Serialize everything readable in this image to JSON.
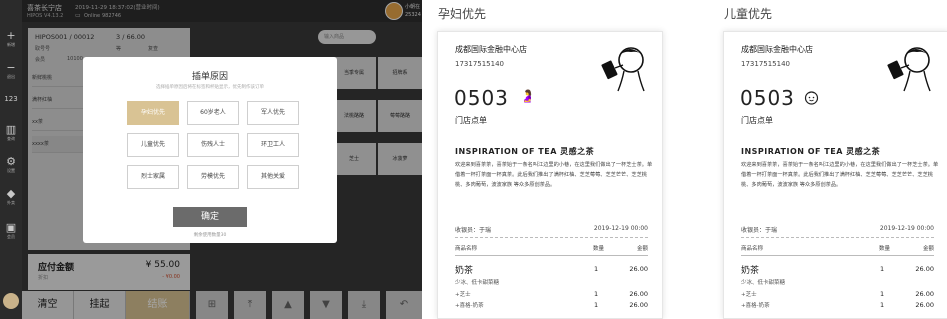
{
  "pos": {
    "header": {
      "store_name": "喜茶长宁店",
      "version": "HIPOS V4.13.2",
      "datetime": "2019-11-29 18:37:02(营业时间)",
      "online_status": "Online",
      "terminal_id": "982746",
      "user_name": "小朝在",
      "user_id": "25324"
    },
    "rail": [
      "新增",
      "退出",
      "123",
      "查询",
      "设置",
      "外卖",
      "会员"
    ],
    "order": {
      "order_no": "HIPOS001 / 00012",
      "progress": "3 / 66.00",
      "row2_a": "取号号",
      "row2_b": "等",
      "row2_c": "复查",
      "row3_a": "会员",
      "row3_b": "10100",
      "items": [
        "新鲜桃桃",
        "满杯红柚",
        "xx茶",
        "xxxx茶"
      ]
    },
    "amount": {
      "label": "应付金额",
      "sub": "折扣",
      "value": "¥ 55.00",
      "discount": "- ¥0.00"
    },
    "buttons": {
      "clear": "清空",
      "hold": "挂起",
      "checkout": "结账"
    },
    "search_placeholder": "输入商品",
    "categories": [
      "当季专属",
      "招牌系",
      "古",
      "法桃酪酪",
      "莓莓酪酪",
      "",
      "芝士",
      "冰菠萝"
    ],
    "keypad": [
      "⊞",
      "⤒",
      "▲",
      "▼",
      "⤓",
      "↶"
    ]
  },
  "modal": {
    "title": "插单原因",
    "subtitle": "选择插单原因后将在标签和杯贴显示，优先制作该订单",
    "reasons": [
      "孕妇优先",
      "60岁老人",
      "军人优先",
      "儿童优先",
      "伤残人士",
      "环卫工人",
      "烈士家属",
      "劳模优先",
      "其他关爱"
    ],
    "confirm": "确定",
    "count_note": "剩余使用数量30"
  },
  "receipts": [
    {
      "section_title": "孕妇优先",
      "store": "成都国际金融中心店",
      "phone": "17317515140",
      "number": "0503",
      "badge_icon": "pregnant-icon",
      "order_type": "门店点单",
      "brand": "INSPIRATION OF TEA 灵感之茶",
      "body": "欢迎来到喜茶茶，喜茶始于一条名叫江边里的小巷，在这里我们做出了一杯芝士茶。单借着一杯打茶面一杯真茶。此后我们推出了满杯红柚、芝芝莓莓、芝芝芒芒、芝芝桃桃、多肉葡萄，波波家族 等众多原创茶品。",
      "cashier": "收银员：于瑞",
      "datetime": "2019-12-19 00:00",
      "col_name": "商品名称",
      "col_qty": "数量",
      "col_amount": "金额",
      "item_name": "奶茶",
      "item_qty": "1",
      "item_amount": "26.00",
      "item_note": "少冰、低卡甜菜糖",
      "sub_items": [
        {
          "name": "+芝士",
          "qty": "1",
          "amount": "26.00"
        },
        {
          "name": "+喜格-奶茶",
          "qty": "1",
          "amount": "26.00"
        }
      ]
    },
    {
      "section_title": "儿童优先",
      "store": "成都国际金融中心店",
      "phone": "17317515140",
      "number": "0503",
      "badge_icon": "child-face-icon",
      "order_type": "门店点单",
      "brand": "INSPIRATION OF TEA 灵感之茶",
      "body": "欢迎来到喜茶茶，喜茶始于一条名叫江边里的小巷，在这里我们做出了一杯芝士茶。单借着一杯打茶面一杯真茶。此后我们推出了满杯红柚、芝芝莓莓、芝芝芒芒、芝芝桃桃、多肉葡萄，波波家族 等众多原创茶品。",
      "cashier": "收银员：于瑞",
      "datetime": "2019-12-19 00:00",
      "col_name": "商品名称",
      "col_qty": "数量",
      "col_amount": "金额",
      "item_name": "奶茶",
      "item_qty": "1",
      "item_amount": "26.00",
      "item_note": "少冰、低卡甜菜糖",
      "sub_items": [
        {
          "name": "+芝士",
          "qty": "1",
          "amount": "26.00"
        },
        {
          "name": "+喜格-奶茶",
          "qty": "1",
          "amount": "26.00"
        }
      ]
    }
  ],
  "colors": {
    "accent": "#d9c394",
    "dark_panel": "#3a3a3a",
    "confirm_button": "#6b6b6b"
  }
}
